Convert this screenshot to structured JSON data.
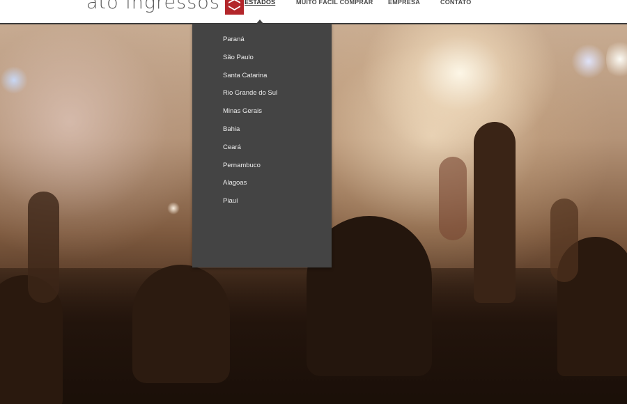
{
  "logo": {
    "text": "ato ingressos",
    "mark_color": "#b3262a"
  },
  "nav": {
    "items": [
      {
        "label": "ESTADOS",
        "active": true
      },
      {
        "label": "MUITO FÁCIL COMPRAR",
        "active": false
      },
      {
        "label": "EMPRESA",
        "active": false
      },
      {
        "label": "CONTATO",
        "active": false
      }
    ]
  },
  "dropdown": {
    "items": [
      "Paraná",
      "São Paulo",
      "Santa Catarina",
      "Rio Grande do Sul",
      "Minas Gerais",
      "Bahia",
      "Ceará",
      "Pernambuco",
      "Alagoas",
      "Piauí"
    ]
  },
  "colors": {
    "header_bg": "#ffffff",
    "header_border": "#3a3a3a",
    "dropdown_bg": "#444444",
    "brand_red": "#b3262a"
  }
}
